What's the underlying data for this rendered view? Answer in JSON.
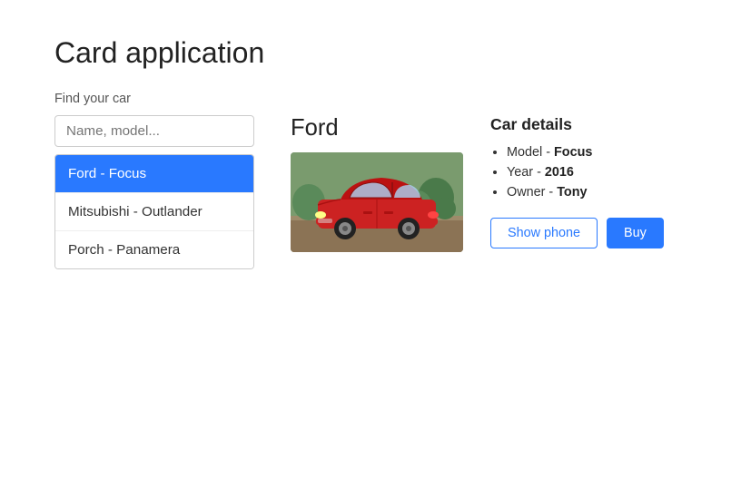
{
  "page": {
    "title": "Card application"
  },
  "search": {
    "label": "Find your car",
    "placeholder": "Name, model..."
  },
  "car_list": {
    "items": [
      {
        "id": "ford-focus",
        "label": "Ford - Focus",
        "active": true
      },
      {
        "id": "mitsubishi-outlander",
        "label": "Mitsubishi - Outlander",
        "active": false
      },
      {
        "id": "porch-panamera",
        "label": "Porch - Panamera",
        "active": false
      }
    ]
  },
  "selected_car": {
    "brand": "Ford",
    "model_label": "Model",
    "model_value": "Focus",
    "year_label": "Year",
    "year_value": "2016",
    "owner_label": "Owner",
    "owner_value": "Tony"
  },
  "car_details": {
    "title": "Car details",
    "details": [
      {
        "label": "Model",
        "separator": " - ",
        "value": "Focus"
      },
      {
        "label": "Year",
        "separator": " - ",
        "value": "2016"
      },
      {
        "label": "Owner",
        "separator": " - ",
        "value": "Tony"
      }
    ]
  },
  "buttons": {
    "show_phone": "Show phone",
    "buy": "Buy"
  },
  "colors": {
    "accent": "#2979ff",
    "active_bg": "#2979ff",
    "active_text": "#ffffff"
  }
}
